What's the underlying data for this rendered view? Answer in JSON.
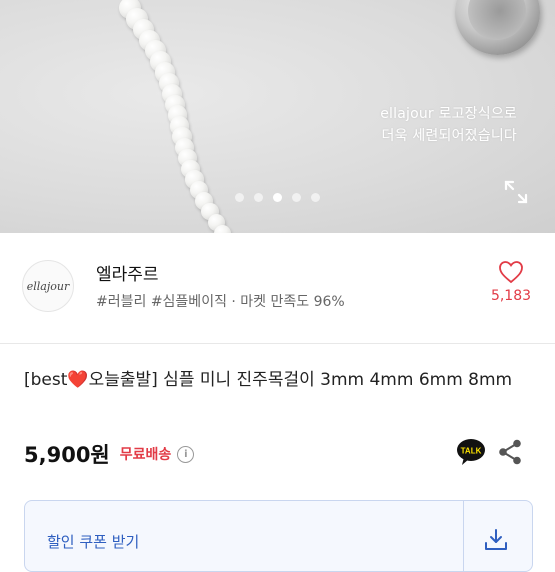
{
  "hero": {
    "caption_line1": "ellajour 로고장식으로",
    "caption_line2": "더욱 세련되어졌습니다",
    "slide_count": 5,
    "active_slide": 3
  },
  "seller": {
    "avatar_text": "ellajour",
    "name": "엘라주르",
    "tags": "#러블리 #심플베이직 · 마켓 만족도 96%",
    "like_count": "5,183"
  },
  "product": {
    "title_prefix": "[best",
    "title_heart": "❤️",
    "title_rest": "오늘출발] 심플 미니 진주목걸이 3mm 4mm 6mm 8mm",
    "price": "5,900원",
    "shipping": "무료배송",
    "info_icon_text": "i"
  },
  "actions": {
    "talk_label": "TALK"
  },
  "coupon": {
    "label": "할인 쿠폰 받기"
  },
  "colors": {
    "accent_red": "#e23b46",
    "coupon_blue": "#2f5fc0",
    "talk_yellow": "#fae100"
  }
}
